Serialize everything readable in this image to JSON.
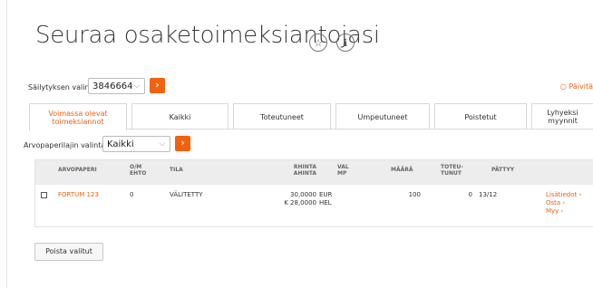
{
  "page": {
    "title": "Seuraa osaketoimeksiantojasi"
  },
  "icons": {
    "star": "star-icon",
    "info": "info-icon",
    "chevron": "chevron-down-icon",
    "arrow": "arrow-right-icon",
    "refresh": "refresh-icon"
  },
  "colors": {
    "accent": "#f4600f",
    "header_bg": "#ededed"
  },
  "custody": {
    "label": "Säilytyksen valinta:",
    "value": "3846664",
    "go_label": "›"
  },
  "refresh_label": "Päivitä",
  "tabs": [
    {
      "label": "Voimassa olevat toimeksiannot",
      "active": true
    },
    {
      "label": "Kaikki",
      "active": false
    },
    {
      "label": "Toteutuneet",
      "active": false
    },
    {
      "label": "Umpeutuneet",
      "active": false
    },
    {
      "label": "Poistetut",
      "active": false
    },
    {
      "label": "Lyhyeksi myynnit",
      "active": false
    }
  ],
  "security_type": {
    "label": "Arvopaperilajin valinta:",
    "value": "Kaikki",
    "go_label": "›"
  },
  "table": {
    "headers": {
      "security": "ARVOPAPERI",
      "om_line1": "O/M",
      "om_line2": "EHTO",
      "status": "TILA",
      "price_line1": "RHINTA",
      "price_line2": "AHINTA",
      "cur_line1": "VAL",
      "cur_line2": "MP",
      "amount": "MÄÄRÄ",
      "exec_line1": "TOTEU-",
      "exec_line2": "TUNUT",
      "expires": "PÄTTYY"
    },
    "rows": [
      {
        "security": "FORTUM 123",
        "om": "0",
        "status": "VÄLITETTY",
        "price_1": "30,0000",
        "price_2": "K 28,0000",
        "cur_1": "EUR",
        "cur_2": "HEL",
        "amount": "100",
        "executed": "0",
        "expires": "13/12",
        "actions": [
          "Lisätiedot ›",
          "Osta ›",
          "Myy ›"
        ]
      }
    ]
  },
  "delete_button": "Poista valitut"
}
